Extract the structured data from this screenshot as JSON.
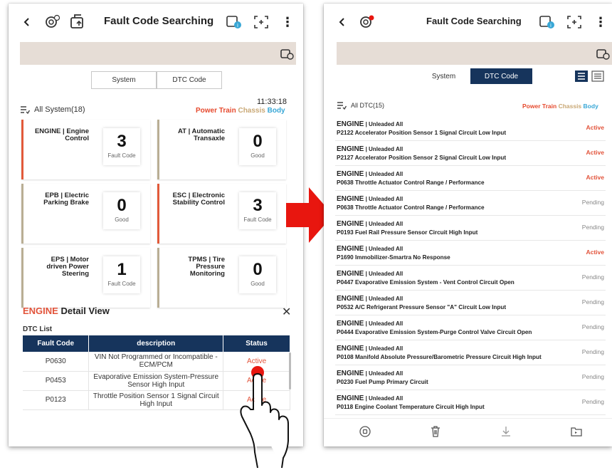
{
  "left": {
    "title": "Fault Code Searching",
    "tabs": [
      {
        "label": "System",
        "active": true
      },
      {
        "label": "DTC Code",
        "active": false
      }
    ],
    "time": "11:33:18",
    "all_system_label": "All System(18)",
    "filters": {
      "power": "Power Train",
      "chassis": "Chassis",
      "body": "Body"
    },
    "cards": [
      {
        "title": "ENGINE | Engine Control",
        "count": "3",
        "state": "Fault Code",
        "accent": "#e25a3a"
      },
      {
        "title": "AT | Automatic Transaxle",
        "count": "0",
        "state": "Good",
        "accent": "#b9ae94"
      },
      {
        "title": "EPB | Electric Parking Brake",
        "count": "0",
        "state": "Good",
        "accent": "#b9ae94"
      },
      {
        "title": "ESC | Electronic Stability Control",
        "count": "3",
        "state": "Fault Code",
        "accent": "#e25a3a"
      },
      {
        "title": "EPS | Motor driven Power Steering",
        "count": "1",
        "state": "Fault Code",
        "accent": "#b9ae94"
      },
      {
        "title": "TPMS | Tire Pressure Monitoring",
        "count": "0",
        "state": "Good",
        "accent": "#b9ae94"
      }
    ],
    "detail": {
      "system": "ENGINE",
      "title": "Detail View",
      "close": "✕",
      "dtc_list_label": "DTC List",
      "columns": [
        "Fault Code",
        "description",
        "Status"
      ],
      "rows": [
        {
          "code": "P0630",
          "description": "VIN Not Programmed or Incompatible - ECM/PCM",
          "status": "Active"
        },
        {
          "code": "P0453",
          "description": "Evaporative Emission System-Pressure Sensor High Input",
          "status": "Active"
        },
        {
          "code": "P0123",
          "description": "Throttle Position Sensor 1 Signal Circuit High Input",
          "status": "Active"
        }
      ]
    }
  },
  "right": {
    "title": "Fault Code Searching",
    "tabs": [
      {
        "label": "System",
        "active": false
      },
      {
        "label": "DTC Code",
        "active": true
      }
    ],
    "all_dtc_label": "All DTC(15)",
    "filters": {
      "power": "Power Train",
      "chassis": "Chassis",
      "body": "Body"
    },
    "items": [
      {
        "system": "ENGINE",
        "sub": "Unleaded All",
        "desc": "P2122 Accelerator Position Sensor 1 Signal Circuit Low Input",
        "status": "Active"
      },
      {
        "system": "ENGINE",
        "sub": "Unleaded All",
        "desc": "P2127 Accelerator Position Sensor 2 Signal Circuit Low Input",
        "status": "Active"
      },
      {
        "system": "ENGINE",
        "sub": "Unleaded All",
        "desc": "P0638 Throttle Actuator Control Range / Performance",
        "status": "Active"
      },
      {
        "system": "ENGINE",
        "sub": "Unleaded All",
        "desc": "P0638 Throttle Actuator Control Range / Performance",
        "status": "Pending"
      },
      {
        "system": "ENGINE",
        "sub": "Unleaded All",
        "desc": "P0193 Fuel Rail Pressure Sensor Circuit High Input",
        "status": "Pending"
      },
      {
        "system": "ENGINE",
        "sub": "Unleaded All",
        "desc": "P1690 Immobilizer-Smartra No Response",
        "status": "Active"
      },
      {
        "system": "ENGINE",
        "sub": "Unleaded All",
        "desc": "P0447 Evaporative Emission System - Vent Control Circuit Open",
        "status": "Pending"
      },
      {
        "system": "ENGINE",
        "sub": "Unleaded All",
        "desc": "P0532 A/C Refrigerant Pressure Sensor \"A\" Circuit Low Input",
        "status": "Pending"
      },
      {
        "system": "ENGINE",
        "sub": "Unleaded All",
        "desc": "P0444 Evaporative Emission System-Purge Control Valve Circuit Open",
        "status": "Pending"
      },
      {
        "system": "ENGINE",
        "sub": "Unleaded All",
        "desc": "P0108 Manifold Absolute Pressure/Barometric Pressure Circuit High Input",
        "status": "Pending"
      },
      {
        "system": "ENGINE",
        "sub": "Unleaded All",
        "desc": "P0230 Fuel Pump Primary Circuit",
        "status": "Pending"
      },
      {
        "system": "ENGINE",
        "sub": "Unleaded All",
        "desc": "P0118 Engine Coolant Temperature Circuit High Input",
        "status": "Pending"
      }
    ]
  },
  "colors": {
    "navy": "#16345c",
    "active_red": "#e2533a",
    "arrow_red": "#e8160f",
    "power_train": "#e64a2e",
    "chassis": "#c9a875",
    "body": "#38a7d6"
  }
}
